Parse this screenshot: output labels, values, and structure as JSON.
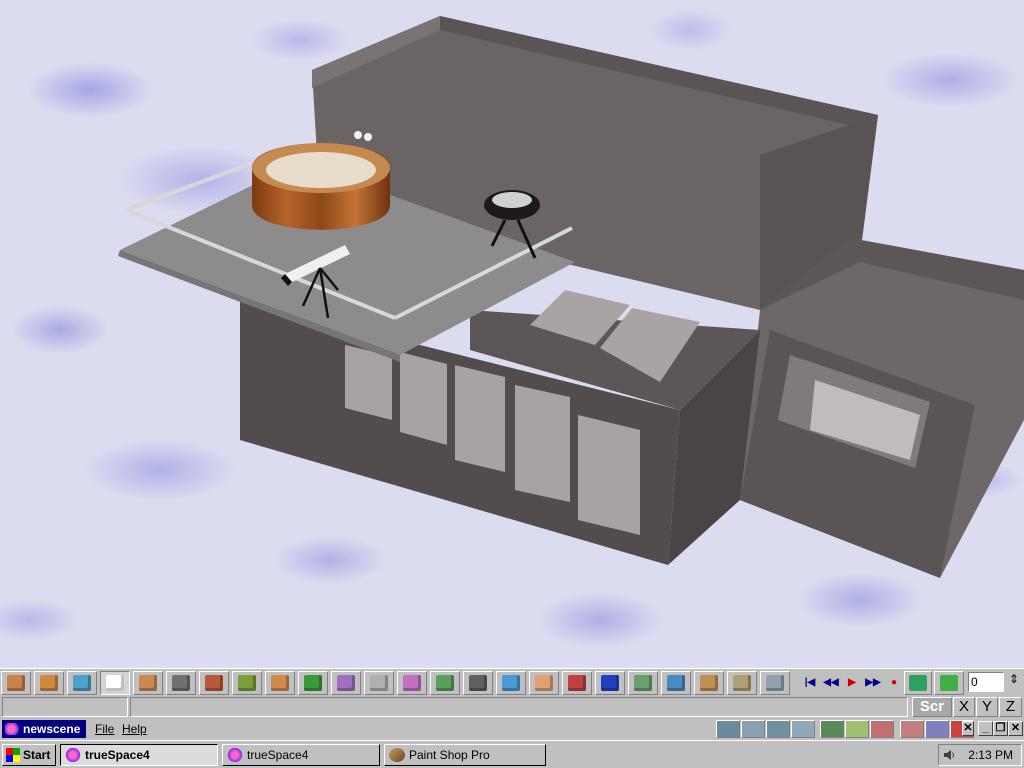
{
  "app": {
    "scene_name": "newscene",
    "menu": [
      "File",
      "Help"
    ]
  },
  "toolbar": {
    "tools": [
      {
        "name": "eye-move-icon",
        "color": "#c9824a"
      },
      {
        "name": "object-cube-icon",
        "color": "#d08a3c"
      },
      {
        "name": "paint-icon",
        "color": "#4aa3c9"
      },
      {
        "name": "select-arrow-icon",
        "color": "#ffffff"
      },
      {
        "name": "object-move-icon",
        "color": "#c98a50"
      },
      {
        "name": "down-arrow-icon",
        "color": "#707070"
      },
      {
        "name": "material-cube-icon",
        "color": "#b85a3a"
      },
      {
        "name": "primitive-plane-icon",
        "color": "#7a9e3a"
      },
      {
        "name": "sphere-icon",
        "color": "#d28a4a"
      },
      {
        "name": "boolean-icon",
        "color": "#3a9a3a"
      },
      {
        "name": "deform-icon",
        "color": "#a070c0"
      },
      {
        "name": "spline-icon",
        "color": "#b0b0b0"
      },
      {
        "name": "funnel-icon",
        "color": "#c070c0"
      },
      {
        "name": "cube-stack-icon",
        "color": "#5aa05a"
      },
      {
        "name": "grid-panel-icon",
        "color": "#606060"
      },
      {
        "name": "blue-cube-icon",
        "color": "#4a9ad8"
      },
      {
        "name": "figure-icon",
        "color": "#e0a070"
      },
      {
        "name": "axes-icon",
        "color": "#c04040"
      },
      {
        "name": "grid-icon",
        "color": "#2040c0"
      },
      {
        "name": "render-landscape-icon",
        "color": "#6aa06a"
      },
      {
        "name": "render-3d-icon",
        "color": "#4a8ac0"
      },
      {
        "name": "light-icon",
        "color": "#c09050"
      },
      {
        "name": "camera-icon",
        "color": "#b0a070"
      },
      {
        "name": "scene-icon",
        "color": "#90a0b0"
      }
    ],
    "frame_value": "0"
  },
  "status": {
    "axis_buttons": [
      "Scr",
      "X",
      "Y",
      "Z"
    ]
  },
  "taskbar": {
    "start_label": "Start",
    "tasks": [
      {
        "label": "trueSpace4",
        "active": true
      },
      {
        "label": "trueSpace4",
        "active": false
      },
      {
        "label": "Paint Shop Pro",
        "active": false
      }
    ],
    "clock": "2:13 PM"
  }
}
